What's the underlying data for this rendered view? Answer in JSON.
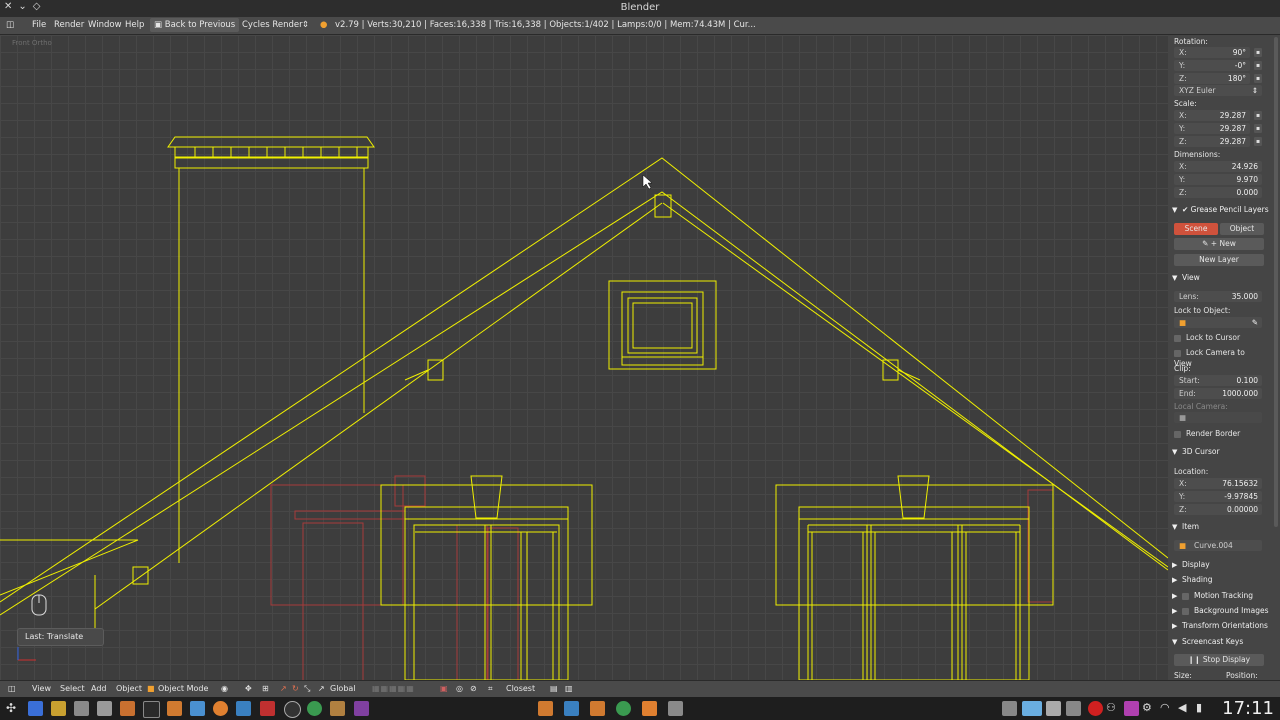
{
  "window": {
    "title": "Blender"
  },
  "infobar": {
    "menu": [
      "File",
      "Render",
      "Window",
      "Help"
    ],
    "back_button": "Back to Previous",
    "render_engine": "Cycles Render",
    "stats": "v2.79 | Verts:30,210 | Faces:16,338 | Tris:16,338 | Objects:1/402 | Lamps:0/0 | Mem:74.43M | Cur..."
  },
  "viewport": {
    "ortho_label": "Front Ortho",
    "last_operator": "Last: Translate",
    "colors": {
      "selected_wire": "#f0f000",
      "unselected_wire": "#b03030"
    }
  },
  "panel": {
    "rotation": {
      "label": "Rotation:",
      "x": "90°",
      "y": "-0°",
      "z": "180°",
      "mode": "XYZ Euler"
    },
    "scale": {
      "label": "Scale:",
      "x": "29.287",
      "y": "29.287",
      "z": "29.287"
    },
    "dimensions": {
      "label": "Dimensions:",
      "x": "24.926",
      "y": "9.970",
      "z": "0.000"
    },
    "grease_pencil": {
      "title": "Grease Pencil Layers",
      "tab_scene": "Scene",
      "tab_object": "Object",
      "new": "New",
      "new_layer": "New Layer"
    },
    "view": {
      "title": "View",
      "lens_label": "Lens:",
      "lens": "35.000",
      "lock_to_object": "Lock to Object:",
      "lock_to_cursor": "Lock to Cursor",
      "lock_camera": "Lock Camera to View",
      "clip": "Clip:",
      "start_label": "Start:",
      "start": "0.100",
      "end_label": "End:",
      "end": "1000.000",
      "local_camera": "Local Camera:",
      "render_border": "Render Border"
    },
    "cursor": {
      "title": "3D Cursor",
      "location": "Location:",
      "x": "76.15632",
      "y": "-9.97845",
      "z": "0.00000"
    },
    "item": {
      "title": "Item",
      "name": "Curve.004"
    },
    "collapsed": [
      "Display",
      "Shading",
      "Motion Tracking",
      "Background Images",
      "Transform Orientations"
    ],
    "screencast": {
      "title": "Screencast Keys",
      "stop": "Stop Display",
      "size": "Size:",
      "position": "Position:"
    },
    "axis_labels": {
      "x": "X:",
      "y": "Y:",
      "z": "Z:"
    }
  },
  "bottombar": {
    "menu": [
      "View",
      "Select",
      "Add",
      "Object"
    ],
    "mode": "Object Mode",
    "orientation": "Global",
    "snap": "Closest"
  },
  "taskbar": {
    "clock": "17:11"
  }
}
